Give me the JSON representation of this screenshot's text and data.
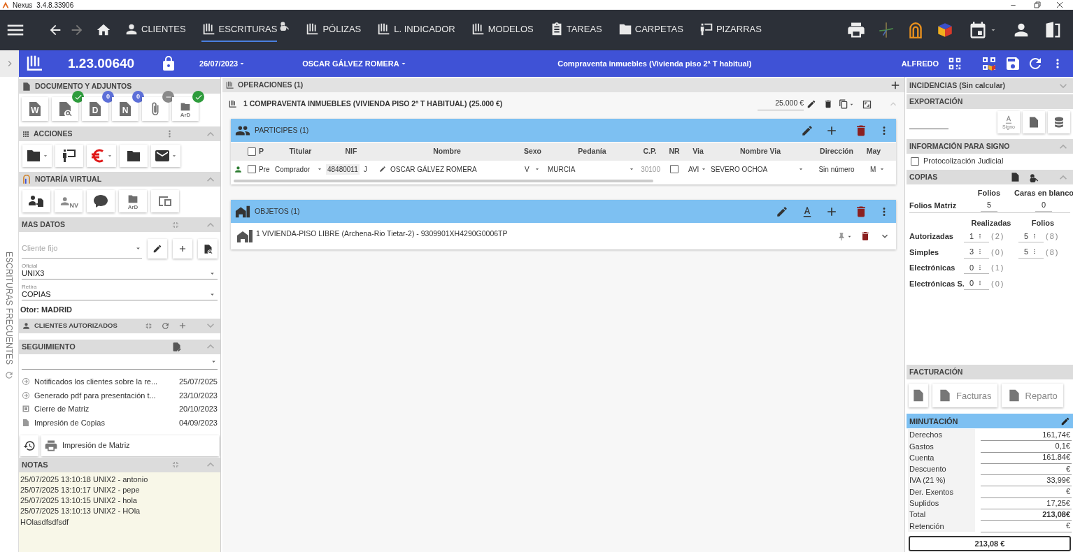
{
  "app": {
    "name": "Nexus",
    "version": "3.4.8.33906"
  },
  "nav": {
    "tabs": [
      {
        "label": "CLIENTES",
        "selected": false
      },
      {
        "label": "ESCRITURAS",
        "selected": true
      },
      {
        "label": "PÓLIZAS",
        "selected": false
      },
      {
        "label": "L. INDICADOR",
        "selected": false
      },
      {
        "label": "MODELOS",
        "selected": false
      },
      {
        "label": "TAREAS",
        "selected": false
      },
      {
        "label": "CARPETAS",
        "selected": false
      },
      {
        "label": "PIZARRAS",
        "selected": false
      }
    ]
  },
  "header": {
    "number": "1.23.00640",
    "locked": true,
    "date": "26/07/2023",
    "client": "OSCAR GÁLVEZ ROMERA",
    "description": "Compraventa inmuebles (Vivienda piso 2ª T habitual)",
    "user": "ALFREDO"
  },
  "frequent": {
    "label": "ESCRITURAS FRECUENTES"
  },
  "documents": {
    "title": "DOCUMENTO Y ADJUNTOS",
    "buttons": [
      {
        "kind": "letter",
        "glyph": "W"
      },
      {
        "kind": "preview",
        "badge": {
          "kind": "check"
        }
      },
      {
        "kind": "letter",
        "glyph": "D",
        "badge": {
          "kind": "count",
          "text": "0"
        }
      },
      {
        "kind": "letter",
        "glyph": "N",
        "badge": {
          "kind": "count",
          "text": "0"
        }
      },
      {
        "kind": "attach",
        "badge": {
          "kind": "minus"
        }
      },
      {
        "kind": "ard",
        "glyph": "ArD",
        "badge": {
          "kind": "check"
        }
      }
    ]
  },
  "actions": {
    "title": "ACCIONES",
    "expanded": true,
    "buttons": [
      {
        "kind": "folder",
        "menu": true
      },
      {
        "kind": "presenter",
        "menu": false
      },
      {
        "kind": "euro",
        "menu": true
      },
      {
        "kind": "drawer",
        "menu": false
      },
      {
        "kind": "mail",
        "menu": true
      }
    ]
  },
  "virtual": {
    "title": "NOTARÍA VIRTUAL",
    "expanded": true,
    "buttons": [
      {
        "kind": "transfer"
      },
      {
        "kind": "nv",
        "glyph": "NV"
      },
      {
        "kind": "chat"
      },
      {
        "kind": "ard",
        "glyph": "ArD"
      },
      {
        "kind": "devices"
      }
    ]
  },
  "more": {
    "title": "MAS DATOS",
    "expanded": true,
    "client_field": {
      "placeholder": "Cliente fijo"
    },
    "officer": {
      "label": "Oficial",
      "value": "UNIX3"
    },
    "pickup": {
      "label": "Retira",
      "value": "COPIAS"
    },
    "grantor": "Otor: MADRID"
  },
  "authorized": {
    "title": "CLIENTES AUTORIZADOS",
    "expanded": false
  },
  "tracking": {
    "title": "SEGUIMIENTO",
    "expanded": true,
    "entries": [
      {
        "kind": "notice",
        "text": "Notificados los clientes sobre la re...",
        "date": "25/07/2025"
      },
      {
        "kind": "notice",
        "text": "Generado pdf para presentación t...",
        "date": "23/10/2023"
      },
      {
        "kind": "matrix",
        "text": "Cierre de Matriz",
        "date": "20/10/2023"
      },
      {
        "kind": "copies",
        "text": "Impresión de Copias",
        "date": "04/09/2023"
      }
    ],
    "action": "Impresión de Matriz"
  },
  "notes": {
    "title": "NOTAS",
    "expanded": true,
    "lines": [
      "25/07/2025 13:10:18 UNIX2 - antonio",
      "25/07/2025 13:10:17 UNIX2 - pepe",
      "25/07/2025 13:10:15 UNIX2 - hola",
      "25/07/2025 13:10:13 UNIX2 - HOla",
      "HOlasdfsdfsdf"
    ]
  },
  "operations": {
    "title": "OPERACIONES (1)",
    "items": [
      {
        "title": "1 COMPRAVENTA INMUEBLES (VIVIENDA PISO 2ª T HABITUAL) (25.000 €)",
        "amount": "25.000 €"
      }
    ]
  },
  "participants": {
    "title": "PARTICIPES (1)",
    "all_selected": false,
    "columns": [
      "P",
      "Titular",
      "NIF",
      "Nombre",
      "Sexo",
      "Pedanía",
      "C.P.",
      "NR",
      "Via",
      "Nombre Via",
      "Dirección",
      "May"
    ],
    "rows": [
      {
        "selected": false,
        "p": "Pre",
        "titular": "Comprador",
        "nif": "48480011",
        "nif_letter": "J",
        "name": "OSCAR GÁLVEZ ROMERA",
        "sex": "V",
        "district": "MURCIA",
        "postcode": "30100",
        "nr": false,
        "street_type": "AVI",
        "street": "SEVERO OCHOA",
        "address": "Sin número",
        "column_12": "M"
      }
    ]
  },
  "objects": {
    "title": "OBJETOS (1)",
    "items": [
      "1 VIVIENDA-PISO LIBRE (Archena-Rio Tietar-2) - 9309901XH4290G0006TP"
    ]
  },
  "incidents": {
    "title": "INCIDENCIAS (Sin calcular)",
    "expanded": false
  },
  "export": {
    "title": "EXPORTACIÓN",
    "signo_glyph": "Signo"
  },
  "signo_info": {
    "title": "INFORMACIÓN PARA SIGNO",
    "expanded": true,
    "checkbox": {
      "label": "Protocolización Judicial",
      "checked": false
    }
  },
  "copies": {
    "title": "COPIAS",
    "expanded": true,
    "matrix_headers": [
      "Folios",
      "Caras en blanco"
    ],
    "matrix": {
      "label": "Folios Matriz",
      "values": [
        "5",
        "0"
      ]
    },
    "headers": [
      "Realizadas",
      "Folios"
    ],
    "rows": [
      {
        "label": "Autorizadas",
        "made": "1",
        "made_note": "(2)",
        "folios": "5",
        "folios_note": "(8)"
      },
      {
        "label": "Simples",
        "made": "3",
        "made_note": "(0)",
        "folios": "5",
        "folios_note": "(8)"
      },
      {
        "label": "Electrónicas",
        "made": "0",
        "made_note": "(1)"
      },
      {
        "label": "Electrónicas S.",
        "made": "0",
        "made_note": "(0)"
      }
    ]
  },
  "billing": {
    "title": "FACTURACIÓN",
    "buttons": [
      "Facturas",
      "Reparto"
    ]
  },
  "fees": {
    "title": "MINUTACIÓN",
    "rows": [
      {
        "label": "Derechos",
        "value": "161,74€",
        "bold": false
      },
      {
        "label": "Gastos",
        "value": "0,1€",
        "bold": false
      },
      {
        "label": "Cuenta",
        "value": "161.84€",
        "bold": false
      },
      {
        "label": "Descuento",
        "value": "€",
        "bold": false
      },
      {
        "label": "IVA (21 %)",
        "value": "33,99€",
        "bold": false
      },
      {
        "label": "Der. Exentos",
        "value": "€",
        "bold": false
      },
      {
        "label": "Suplidos",
        "value": "17,25€",
        "bold": false
      },
      {
        "label": "Total",
        "value": "213,08€",
        "bold": true
      },
      {
        "label": "Retención",
        "value": "€",
        "bold": false
      }
    ],
    "total": "213,08 €"
  }
}
